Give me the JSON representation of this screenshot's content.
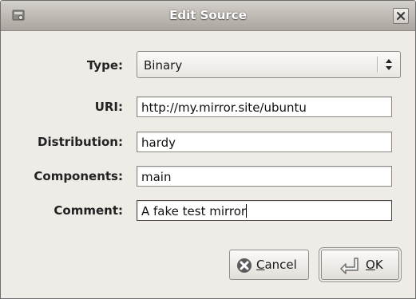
{
  "window": {
    "title": "Edit Source"
  },
  "form": {
    "type": {
      "label": "Type:",
      "value": "Binary"
    },
    "uri": {
      "label": "URI:",
      "value": "http://my.mirror.site/ubuntu"
    },
    "distribution": {
      "label": "Distribution:",
      "value": "hardy"
    },
    "components": {
      "label": "Components:",
      "value": "main"
    },
    "comment": {
      "label": "Comment:",
      "value": "A fake test mirror"
    }
  },
  "buttons": {
    "cancel": {
      "mnemonic": "C",
      "rest": "ancel"
    },
    "ok": {
      "mnemonic": "O",
      "rest": "K"
    }
  },
  "icons": {
    "window": "window-menu-icon",
    "close": "close-icon",
    "combo": "up-down-arrows-icon",
    "cancel": "cancel-icon",
    "ok": "enter-arrow-icon"
  }
}
